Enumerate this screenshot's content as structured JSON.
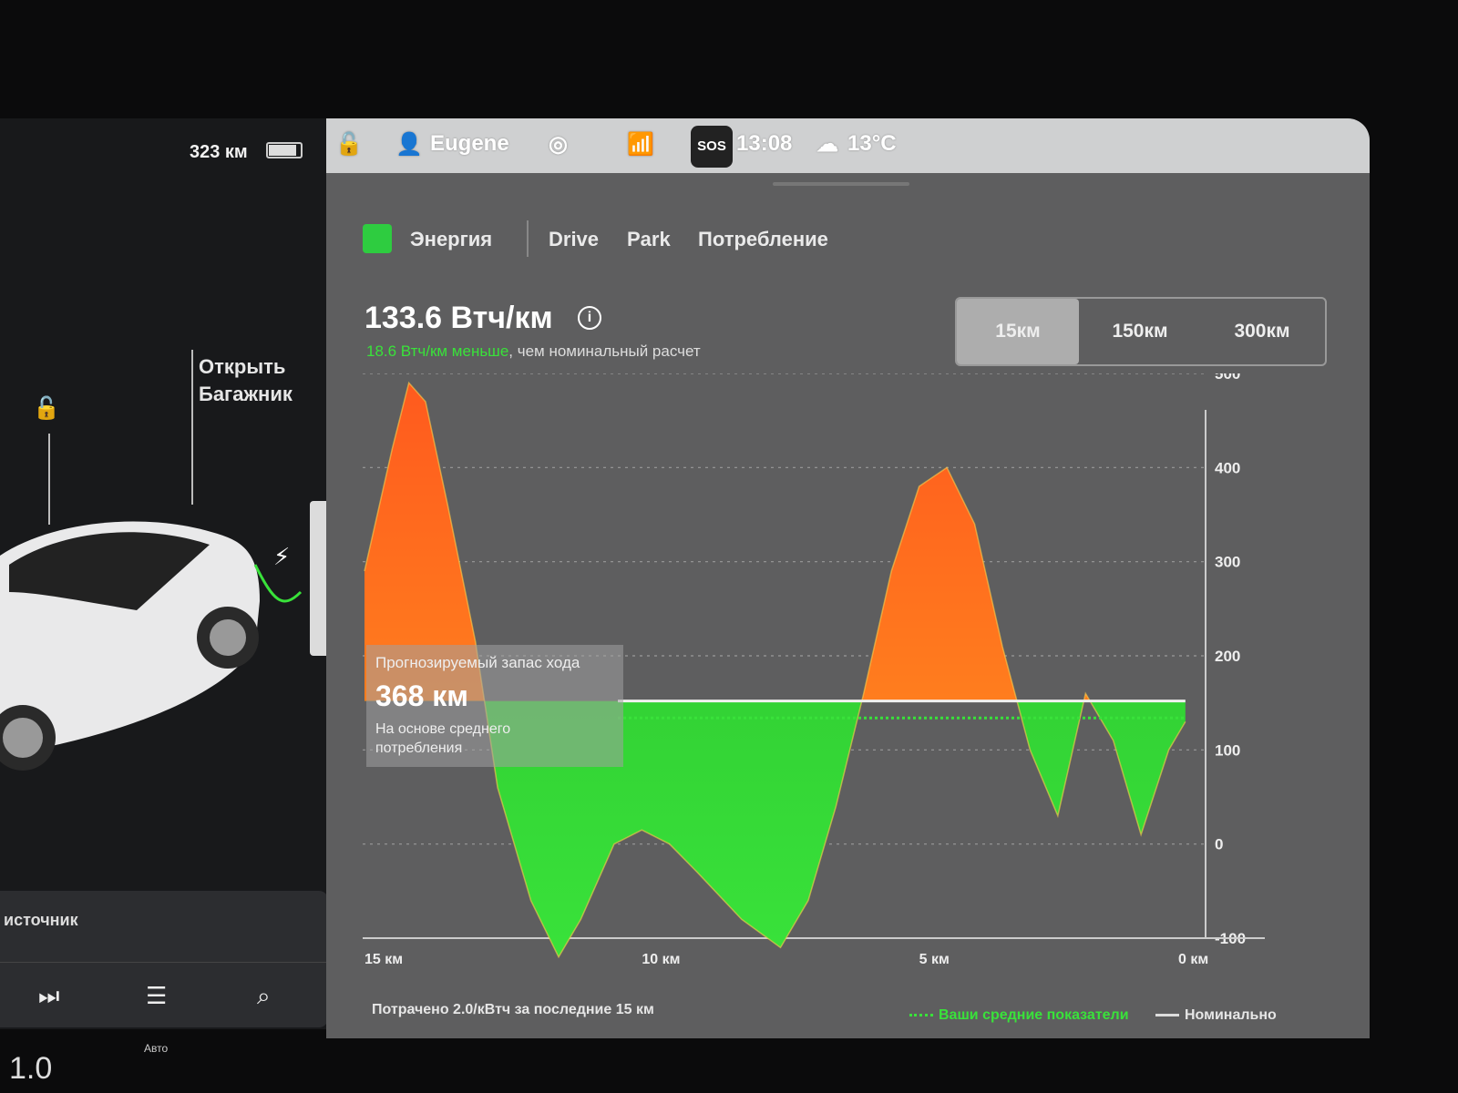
{
  "left_panel": {
    "range": "323 км",
    "trunk_label_1": "Открыть",
    "trunk_label_2": "Багажник",
    "media_source": "источник",
    "media_controls": [
      "next-icon",
      "equalizer-icon",
      "search-icon"
    ]
  },
  "status_bar": {
    "user": "Eugene",
    "sos": "SOS",
    "time": "13:08",
    "temperature": "13°C",
    "icons": [
      "lock-icon",
      "user-icon",
      "target-icon",
      "no-signal-icon",
      "weather-icon"
    ]
  },
  "tabs": {
    "energy": "Энергия",
    "drive": "Drive",
    "park": "Park",
    "consumption": "Потребление"
  },
  "summary": {
    "value": "133.6 Втч/км",
    "diff": "18.6 Втч/км меньше",
    "diff_suffix": ", чем номинальный расчет"
  },
  "distance_selector": {
    "options": [
      "15км",
      "150км",
      "300км"
    ],
    "selected": "15км"
  },
  "tooltip": {
    "title": "Прогнозируемый запас хода",
    "value": "368 км",
    "note": "На основе среднего потребления"
  },
  "footer": {
    "spent": "Потрачено 2.0/кВтч за последние 15 км",
    "legend_avg": "Ваши средние показатели",
    "legend_nominal": "Номинально"
  },
  "dock": {
    "auto": "Авто",
    "temp": "1.0"
  },
  "colors": {
    "positive": "#39e23a",
    "above": "#ff9a1e",
    "above_peak": "#ff5a1e"
  },
  "chart_data": {
    "type": "area",
    "ylabel": "Втч/км",
    "ylim": [
      -100,
      500
    ],
    "yticks": [
      500,
      400,
      300,
      200,
      100,
      0,
      -100
    ],
    "xticks": [
      "15 км",
      "10 км",
      "5 км",
      "0 км"
    ],
    "xlim": [
      15,
      0
    ],
    "nominal": 152,
    "average": 134,
    "x": [
      15,
      14.5,
      14.2,
      13.9,
      13.5,
      13.0,
      12.6,
      12.0,
      11.5,
      11.1,
      10.5,
      10.0,
      9.5,
      9.0,
      8.2,
      7.5,
      7.0,
      6.5,
      6.0,
      5.5,
      5.0,
      4.5,
      4.0,
      3.5,
      3.0,
      2.5,
      2.0,
      1.5,
      1.0,
      0.5,
      0.2
    ],
    "values": [
      290,
      420,
      490,
      470,
      360,
      215,
      60,
      -60,
      -120,
      -80,
      0,
      15,
      0,
      -30,
      -80,
      -110,
      -60,
      40,
      160,
      290,
      380,
      400,
      340,
      210,
      100,
      30,
      160,
      110,
      10,
      100,
      130
    ]
  }
}
